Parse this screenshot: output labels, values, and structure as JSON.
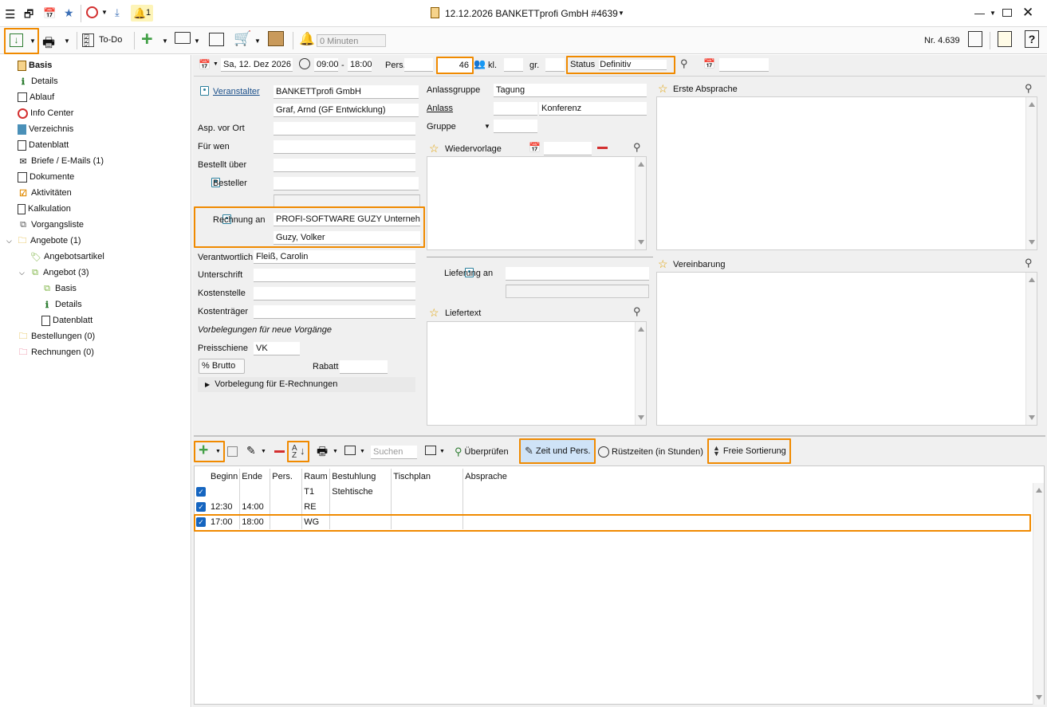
{
  "window": {
    "title": "12.12.2026 BANKETTprofi GmbH #4639",
    "badge_count": "1"
  },
  "toolbar": {
    "todo_label": "To-Do",
    "reminder_value": "0 Minuten",
    "number_label": "Nr. 4.639"
  },
  "sidebar": {
    "items": [
      {
        "label": "Basis"
      },
      {
        "label": "Details"
      },
      {
        "label": "Ablauf"
      },
      {
        "label": "Info Center"
      },
      {
        "label": "Verzeichnis"
      },
      {
        "label": "Datenblatt"
      },
      {
        "label": "Briefe / E-Mails (1)"
      },
      {
        "label": "Dokumente"
      },
      {
        "label": "Aktivitäten"
      },
      {
        "label": "Kalkulation"
      },
      {
        "label": "Vorgangsliste"
      },
      {
        "label": "Angebote (1)"
      },
      {
        "label": "Angebotsartikel"
      },
      {
        "label": "Angebot (3)"
      },
      {
        "label": "Basis"
      },
      {
        "label": "Details"
      },
      {
        "label": "Datenblatt"
      },
      {
        "label": "Bestellungen (0)"
      },
      {
        "label": "Rechnungen (0)"
      }
    ]
  },
  "header": {
    "date": "Sa, 12. Dez 2026",
    "time_from": "09:00",
    "time_sep": "-",
    "time_to": "18:00",
    "pers_label": "Pers.",
    "pers_value": "46",
    "kl_label": "kl.",
    "gr_label": "gr.",
    "status_label": "Status",
    "status_value": "Definitiv"
  },
  "form": {
    "veranstalter_label": "Veranstalter",
    "veranstalter_value": "BANKETTprofi GmbH",
    "veranstalter_contact": "Graf, Arnd (GF Entwicklung)",
    "asp_label": "Asp. vor Ort",
    "fuer_wen_label": "Für wen",
    "bestellt_label": "Bestellt über",
    "besteller_label": "Besteller",
    "rechnung_label": "Rechnung an",
    "rechnung_value": "PROFI-SOFTWARE GUZY Unternehme",
    "rechnung_contact": "Guzy, Volker",
    "verantwortlich_label": "Verantwortlich",
    "verantwortlich_value": "Fleiß, Carolin",
    "unterschrift_label": "Unterschrift",
    "kostenstelle_label": "Kostenstelle",
    "kostentraeger_label": "Kostenträger",
    "vorbelegung_label": "Vorbelegungen für neue Vorgänge",
    "preisschiene_label": "Preisschiene",
    "preisschiene_value": "VK",
    "brutto_label": "Brutto",
    "rabatt_label": "Rabatt",
    "erechnung_label": "Vorbelegung für E-Rechnungen",
    "anlassgruppe_label": "Anlassgruppe",
    "anlassgruppe_value": "Tagung",
    "anlass_label": "Anlass",
    "anlass_value": "Konferenz",
    "gruppe_label": "Gruppe",
    "wiedervorlage_label": "Wiedervorlage",
    "lieferung_label": "Lieferung an",
    "liefertext_label": "Liefertext",
    "erste_absprache_label": "Erste Absprache",
    "vereinbarung_label": "Vereinbarung"
  },
  "lower_toolbar": {
    "search_placeholder": "Suchen",
    "pruefen_label": "Überprüfen",
    "zeit_label": "Zeit und Pers.",
    "ruest_label": "Rüstzeiten (in Stunden)",
    "sort_label": "Freie Sortierung"
  },
  "grid": {
    "columns": [
      "Beginn",
      "Ende",
      "Pers.",
      "Raum",
      "Bestuhlung",
      "Tischplan",
      "Absprache"
    ],
    "rows": [
      {
        "beginn": "",
        "ende": "",
        "pers": "",
        "raum": "T1",
        "bestuhlung": "Stehtische",
        "tischplan": "",
        "absprache": ""
      },
      {
        "beginn": "12:30",
        "ende": "14:00",
        "pers": "",
        "raum": "RE",
        "bestuhlung": "",
        "tischplan": "",
        "absprache": ""
      },
      {
        "beginn": "17:00",
        "ende": "18:00",
        "pers": "",
        "raum": "WG",
        "bestuhlung": "",
        "tischplan": "",
        "absprache": ""
      }
    ]
  },
  "colors": {
    "highlight": "#f08a00",
    "accent": "#1565c0",
    "active_button": "#cfe3f7"
  }
}
